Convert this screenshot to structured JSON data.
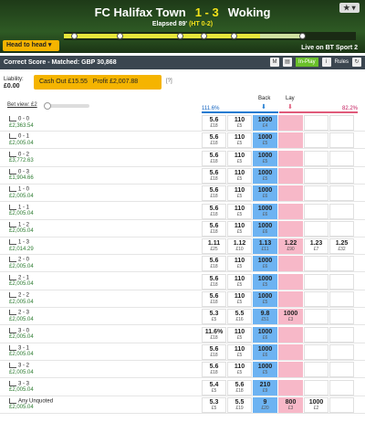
{
  "match": {
    "home": "FC Halifax Town",
    "score": "1 - 3",
    "away": "Woking",
    "elapsed": "Elapsed 89'",
    "ht": "(HT 0-2)",
    "live": "Live on BT Sport 2",
    "h2h": "Head to head"
  },
  "market": {
    "title": "Correct Score - Matched: GBP 30,868",
    "inplay": "In-Play",
    "rules": "Rules"
  },
  "liability": {
    "label": "Liability:",
    "value": "£0.00"
  },
  "cashout": {
    "label": "Cash Out £15.55",
    "profit": "Profit £2,007.88",
    "help": "[?]"
  },
  "betview": "Bet view: £2",
  "head": {
    "back_pct": "111.6%",
    "lay_pct": "82.2%",
    "back": "Back",
    "lay": "Lay"
  },
  "rows": [
    {
      "name": "0 - 0",
      "pl": "£2,363.54",
      "c0": [
        "5.6",
        "£18"
      ],
      "c1": [
        "110",
        "£5"
      ],
      "c2": [
        "1000",
        "£4"
      ],
      "c3": [
        "",
        ""
      ],
      "c4": [
        "",
        ""
      ],
      "c5": [
        "",
        ""
      ]
    },
    {
      "name": "0 - 1",
      "pl": "£2,005.04",
      "c0": [
        "5.6",
        "£18"
      ],
      "c1": [
        "110",
        "£5"
      ],
      "c2": [
        "1000",
        "£5"
      ],
      "c3": [
        "",
        ""
      ],
      "c4": [
        "",
        ""
      ],
      "c5": [
        "",
        ""
      ]
    },
    {
      "name": "0 - 2",
      "pl": "£3,772.63",
      "c0": [
        "5.6",
        "£18"
      ],
      "c1": [
        "110",
        "£5"
      ],
      "c2": [
        "1000",
        "£5"
      ],
      "c3": [
        "",
        ""
      ],
      "c4": [
        "",
        ""
      ],
      "c5": [
        "",
        ""
      ]
    },
    {
      "name": "0 - 3",
      "pl": "£1,904.66",
      "c0": [
        "5.6",
        "£18"
      ],
      "c1": [
        "110",
        "£5"
      ],
      "c2": [
        "1000",
        "£5"
      ],
      "c3": [
        "",
        ""
      ],
      "c4": [
        "",
        ""
      ],
      "c5": [
        "",
        ""
      ]
    },
    {
      "name": "1 - 0",
      "pl": "£2,005.04",
      "c0": [
        "5.6",
        "£18"
      ],
      "c1": [
        "110",
        "£5"
      ],
      "c2": [
        "1000",
        "£6"
      ],
      "c3": [
        "",
        ""
      ],
      "c4": [
        "",
        ""
      ],
      "c5": [
        "",
        ""
      ]
    },
    {
      "name": "1 - 1",
      "pl": "£2,005.04",
      "c0": [
        "5.6",
        "£18"
      ],
      "c1": [
        "110",
        "£5"
      ],
      "c2": [
        "1000",
        "£6"
      ],
      "c3": [
        "",
        ""
      ],
      "c4": [
        "",
        ""
      ],
      "c5": [
        "",
        ""
      ]
    },
    {
      "name": "1 - 2",
      "pl": "£2,005.04",
      "c0": [
        "5.6",
        "£18"
      ],
      "c1": [
        "110",
        "£5"
      ],
      "c2": [
        "1000",
        "£6"
      ],
      "c3": [
        "",
        ""
      ],
      "c4": [
        "",
        ""
      ],
      "c5": [
        "",
        ""
      ]
    },
    {
      "name": "1 - 3",
      "pl": "£2,014.29",
      "c0": [
        "1.11",
        "£25"
      ],
      "c1": [
        "1.12",
        "£10"
      ],
      "c2": [
        "1.13",
        "£11"
      ],
      "c3": [
        "1.22",
        "£90"
      ],
      "c4": [
        "1.23",
        "£7"
      ],
      "c5": [
        "1.25",
        "£32"
      ]
    },
    {
      "name": "2 - 0",
      "pl": "£2,005.04",
      "c0": [
        "5.6",
        "£18"
      ],
      "c1": [
        "110",
        "£5"
      ],
      "c2": [
        "1000",
        "£6"
      ],
      "c3": [
        "",
        ""
      ],
      "c4": [
        "",
        ""
      ],
      "c5": [
        "",
        ""
      ]
    },
    {
      "name": "2 - 1",
      "pl": "£2,005.04",
      "c0": [
        "5.6",
        "£18"
      ],
      "c1": [
        "110",
        "£5"
      ],
      "c2": [
        "1000",
        "£5"
      ],
      "c3": [
        "",
        ""
      ],
      "c4": [
        "",
        ""
      ],
      "c5": [
        "",
        ""
      ]
    },
    {
      "name": "2 - 2",
      "pl": "£2,005.04",
      "c0": [
        "5.6",
        "£18"
      ],
      "c1": [
        "110",
        "£5"
      ],
      "c2": [
        "1000",
        "£5"
      ],
      "c3": [
        "",
        ""
      ],
      "c4": [
        "",
        ""
      ],
      "c5": [
        "",
        ""
      ]
    },
    {
      "name": "2 - 3",
      "pl": "£2,005.04",
      "c0": [
        "5.3",
        "£5"
      ],
      "c1": [
        "5.5",
        "£16"
      ],
      "c2": [
        "9.8",
        "£51"
      ],
      "c3": [
        "1000",
        "£3"
      ],
      "c4": [
        "",
        ""
      ],
      "c5": [
        "",
        ""
      ]
    },
    {
      "name": "3 - 0",
      "pl": "£2,005.04",
      "c0": [
        "11.6%",
        "£18"
      ],
      "c1": [
        "110",
        "£5"
      ],
      "c2": [
        "1000",
        "£6"
      ],
      "c3": [
        "",
        ""
      ],
      "c4": [
        "",
        ""
      ],
      "c5": [
        "",
        ""
      ]
    },
    {
      "name": "3 - 1",
      "pl": "£2,005.04",
      "c0": [
        "5.6",
        "£18"
      ],
      "c1": [
        "110",
        "£5"
      ],
      "c2": [
        "1000",
        "£6"
      ],
      "c3": [
        "",
        ""
      ],
      "c4": [
        "",
        ""
      ],
      "c5": [
        "",
        ""
      ]
    },
    {
      "name": "3 - 2",
      "pl": "£2,005.04",
      "c0": [
        "5.6",
        "£18"
      ],
      "c1": [
        "110",
        "£5"
      ],
      "c2": [
        "1000",
        "£5"
      ],
      "c3": [
        "",
        ""
      ],
      "c4": [
        "",
        ""
      ],
      "c5": [
        "",
        ""
      ]
    },
    {
      "name": "3 - 3",
      "pl": "£2,005.04",
      "c0": [
        "5.4",
        "£5"
      ],
      "c1": [
        "5.6",
        "£18"
      ],
      "c2": [
        "210",
        "£9"
      ],
      "c3": [
        "",
        ""
      ],
      "c4": [
        "",
        ""
      ],
      "c5": [
        "",
        ""
      ]
    },
    {
      "name": "Any Unquoted",
      "pl": "£2,005.04",
      "c0": [
        "5.3",
        "£5"
      ],
      "c1": [
        "5.5",
        "£19"
      ],
      "c2": [
        "9",
        "£20"
      ],
      "c3": [
        "800",
        "£3"
      ],
      "c4": [
        "1000",
        "£2"
      ],
      "c5": [
        "",
        ""
      ]
    }
  ]
}
